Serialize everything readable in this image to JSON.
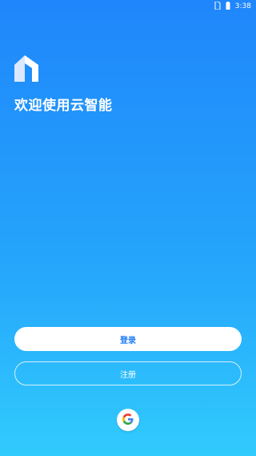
{
  "status_bar": {
    "time": "3:38"
  },
  "welcome": {
    "title": "欢迎使用云智能"
  },
  "buttons": {
    "login_label": "登录",
    "register_label": "注册"
  },
  "icons": {
    "logo": "app-logo-icon",
    "google": "google-icon",
    "battery": "battery-icon",
    "sim": "sim-icon"
  },
  "colors": {
    "gradient_top": "#1f86fb",
    "gradient_bottom": "#31cbfd",
    "accent": "#1e7cf5"
  }
}
